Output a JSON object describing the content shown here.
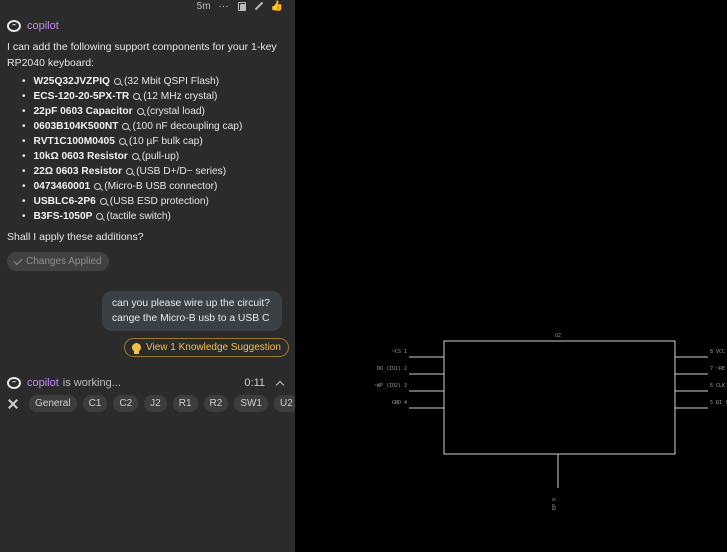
{
  "message_meta": {
    "time": "5m",
    "more": "···",
    "icons": [
      "copy-icon",
      "edit-icon",
      "thumbs-up-icon"
    ]
  },
  "assistant": {
    "name": "copilot",
    "intro": "I can add the following support components for your 1-key RP2040 keyboard:",
    "parts": [
      {
        "pn": "W25Q32JVZPIQ",
        "desc": "(32 Mbit QSPI Flash)"
      },
      {
        "pn": "ECS-120-20-5PX-TR",
        "desc": "(12 MHz crystal)"
      },
      {
        "pn": "22pF 0603 Capacitor",
        "desc": "(crystal load)"
      },
      {
        "pn": "0603B104K500NT",
        "desc": "(100 nF decoupling cap)"
      },
      {
        "pn": "RVT1C100M0405",
        "desc": "(10 µF bulk cap)"
      },
      {
        "pn": "10kΩ 0603 Resistor",
        "desc": "(pull-up)"
      },
      {
        "pn": "22Ω 0603 Resistor",
        "desc": "(USB D+/D− series)"
      },
      {
        "pn": "0473460001",
        "desc": "(Micro-B USB connector)"
      },
      {
        "pn": "USBLC6-2P6",
        "desc": "(USB ESD protection)"
      },
      {
        "pn": "B3FS-1050P",
        "desc": "(tactile switch)"
      }
    ],
    "question": "Shall I apply these additions?",
    "applied_label": "Changes Applied"
  },
  "user_message": {
    "line1": "can you please wire up the circuit?",
    "line2": "cange the Micro-B usb to a USB C"
  },
  "knowledge_button": "View 1 Knowledge Suggestion",
  "working": {
    "name": "copilot",
    "status": "is working...",
    "timer": "0:11"
  },
  "chips": [
    "General",
    "C1",
    "C2",
    "J2",
    "R1",
    "R2",
    "SW1",
    "U2"
  ],
  "schematic": {
    "ref": "U2",
    "left_pins": [
      "~CS 1",
      "DO_(IO1) 2",
      "~WP_(IO2) 3",
      "GND 4"
    ],
    "right_pins": [
      "8 VCC",
      "7 ~RE",
      "6 CLK",
      "5 DI_("
    ],
    "bottom_pin": "EP 9"
  }
}
